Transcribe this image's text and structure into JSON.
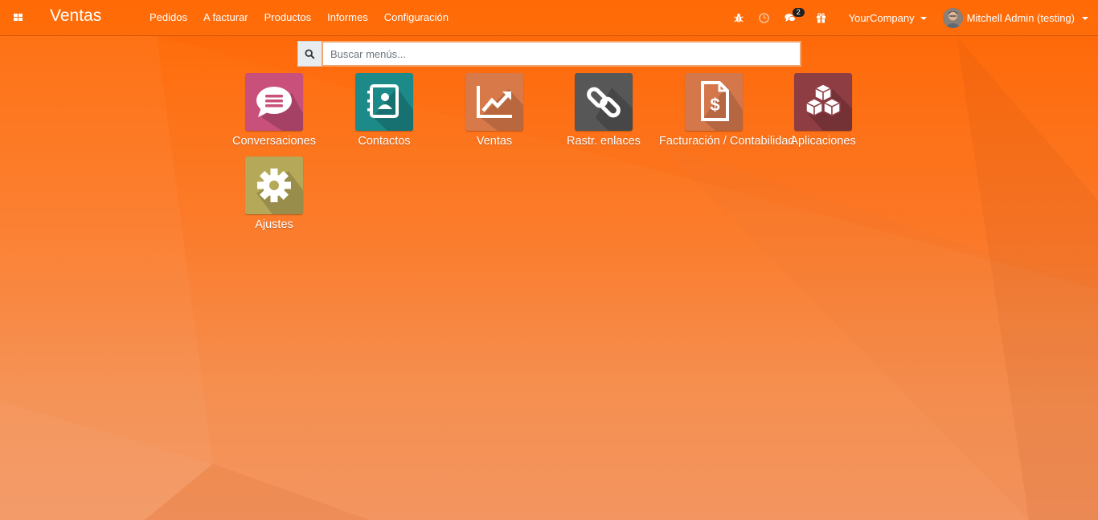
{
  "navbar": {
    "app_title": "Ventas",
    "menu": [
      "Pedidos",
      "A facturar",
      "Productos",
      "Informes",
      "Configuración"
    ],
    "messages_badge": "2",
    "company": "YourCompany",
    "user": "Mitchell Admin (testing)"
  },
  "search": {
    "placeholder": "Buscar menús..."
  },
  "apps": [
    {
      "label": "Conversaciones",
      "icon": "chat-bubble-icon",
      "color": "#c9507a"
    },
    {
      "label": "Contactos",
      "icon": "address-book-icon",
      "color": "#1d8a8a"
    },
    {
      "label": "Ventas",
      "icon": "trending-chart-icon",
      "color": "#d8794a"
    },
    {
      "label": "Rastr. enlaces",
      "icon": "link-icon",
      "color": "#575757"
    },
    {
      "label": "Facturación / Contabilidad",
      "icon": "invoice-dollar-icon",
      "color": "#d4774b"
    },
    {
      "label": "Aplicaciones",
      "icon": "cubes-icon",
      "color": "#8e3d43"
    },
    {
      "label": "Ajustes",
      "icon": "gear-icon",
      "color": "#b5a959"
    }
  ],
  "colors": {
    "navbar": "#ff6a05",
    "background_gradient": [
      "#ff6a05",
      "#f39560"
    ]
  }
}
